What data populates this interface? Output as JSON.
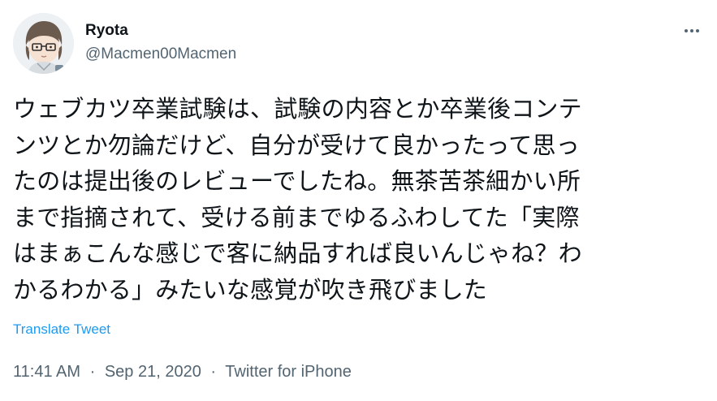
{
  "author": {
    "display_name": "Ryota",
    "handle": "@Macmen00Macmen",
    "avatar_icon": "cartoon-avatar-icon"
  },
  "more_icon": "more-options-icon",
  "tweet": {
    "lines": [
      "ウェブカツ卒業試験は、試験の内容とか卒業後コンテ",
      "ンツとか勿論だけど、自分が受けて良かったって思っ",
      "たのは提出後のレビューでしたね。無茶苦茶細かい所",
      "まで指摘されて、受ける前までゆるふわしてた「実際",
      "はまぁこんな感じで客に納品すれば良いんじゃね？わ",
      "かるわかる」みたいな感覚が吹き飛びました"
    ]
  },
  "translate_label": "Translate Tweet",
  "meta": {
    "time": "11:41 AM",
    "separator": "·",
    "date": "Sep 21, 2020",
    "source": "Twitter for iPhone"
  },
  "colors": {
    "text": "#0f1419",
    "secondary": "#536471",
    "link": "#1d9bf0"
  }
}
